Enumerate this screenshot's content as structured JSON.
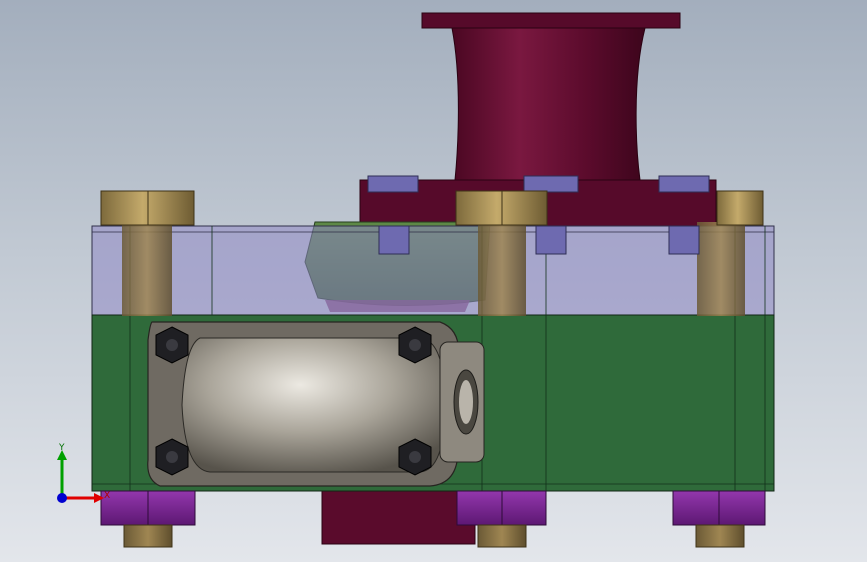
{
  "viewport": {
    "background_top": "#a3aebd",
    "background_bottom": "#e3e6eb"
  },
  "parts": {
    "flange_color": "#5e0b2e",
    "gear_color": "#4f7a3b",
    "bolt_head_color": "#a4894e",
    "upper_plate_color": "#8f88c4",
    "lower_plate_color": "#2f6a3a",
    "nut_color": "#7b2592",
    "housing_color": "#9a958c",
    "hex_screw_color": "#1e1e22"
  },
  "triad": {
    "x_label": "X",
    "y_label": "Y",
    "x_color": "#e00000",
    "y_color": "#00a000",
    "z_color": "#0000d0"
  }
}
